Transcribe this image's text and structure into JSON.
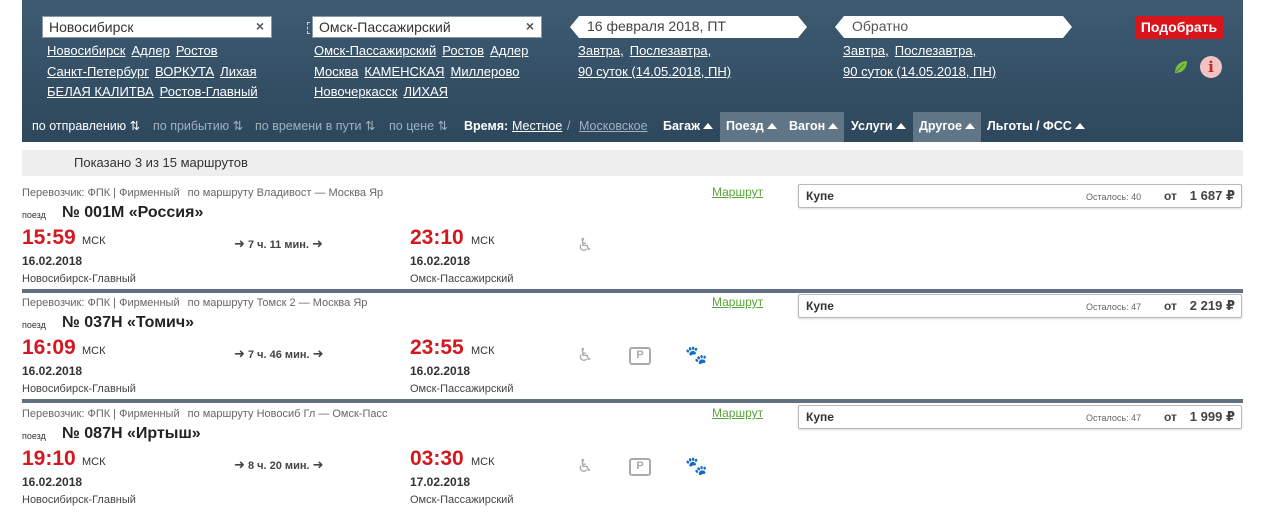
{
  "search": {
    "from_value": "Новосибирск",
    "to_value": "Омск-Пассажирский",
    "date_value": "16 февраля 2018, ПТ",
    "return_placeholder": "Обратно",
    "submit_label": "Подобрать",
    "from_suggestions": [
      "Новосибирск",
      "Адлер",
      "Ростов",
      "Санкт-Петербург",
      "ВОРКУТА",
      "Лихая",
      "БЕЛАЯ КАЛИТВА",
      "Ростов-Главный"
    ],
    "to_suggestions": [
      "Омск-Пассажирский",
      "Ростов",
      "Адлер",
      "Москва",
      "КАМЕНСКАЯ",
      "Миллерово",
      "Новочеркасск",
      "ЛИХАЯ"
    ],
    "date_suggestions": [
      "Завтра,",
      "Послезавтра,",
      "90 суток (14.05.2018, ПН)"
    ],
    "return_suggestions": [
      "Завтра,",
      "Послезавтра,",
      "90 суток (14.05.2018, ПН)"
    ],
    "clear_glyph": "×"
  },
  "filters": {
    "sort_departure": "по отправлению",
    "sort_arrival": "по прибытию",
    "sort_duration": "по времени в пути",
    "sort_price": "по цене",
    "time_label": "Время:",
    "time_local": "Местное",
    "time_sep": "/",
    "time_moscow": "Московское",
    "tabs": [
      "Багаж",
      "Поезд",
      "Вагон",
      "Услуги",
      "Другое",
      "Льготы / ФСС"
    ]
  },
  "summary": "Показано 3 из 15 маршрутов",
  "routes": [
    {
      "carrier": "Перевозчик: ФПК | Фирменный",
      "via": "по маршруту Владивост — Москва Яр",
      "train_label": "поезд",
      "train": "№ 001М «Россия»",
      "dep_time": "15:59",
      "dep_tz": "МСК",
      "dep_date": "16.02.2018",
      "dep_station": "Новосибирск-Главный",
      "duration": "7 ч. 11 мин.",
      "arr_time": "23:10",
      "arr_tz": "МСК",
      "arr_date": "16.02.2018",
      "arr_station": "Омск-Пассажирский",
      "route_link": "Маршрут",
      "coach": {
        "class": "Купе",
        "left": "Осталось: 40",
        "from": "от",
        "price": "1 687 ₽"
      }
    },
    {
      "carrier": "Перевозчик: ФПК | Фирменный",
      "via": "по маршруту Томск 2 — Москва Яр",
      "train_label": "поезд",
      "train": "№ 037Н «Томич»",
      "dep_time": "16:09",
      "dep_tz": "МСК",
      "dep_date": "16.02.2018",
      "dep_station": "Новосибирск-Главный",
      "duration": "7 ч. 46 мин.",
      "arr_time": "23:55",
      "arr_tz": "МСК",
      "arr_date": "16.02.2018",
      "arr_station": "Омск-Пассажирский",
      "route_link": "Маршрут",
      "coach": {
        "class": "Купе",
        "left": "Осталось: 47",
        "from": "от",
        "price": "2 219 ₽"
      }
    },
    {
      "carrier": "Перевозчик: ФПК | Фирменный",
      "via": "по маршруту Новосиб Гл — Омск-Пасс",
      "train_label": "поезд",
      "train": "№ 087Н «Иртыш»",
      "dep_time": "19:10",
      "dep_tz": "МСК",
      "dep_date": "16.02.2018",
      "dep_station": "Новосибирск-Главный",
      "duration": "8 ч. 20 мин.",
      "arr_time": "03:30",
      "arr_tz": "МСК",
      "arr_date": "17.02.2018",
      "arr_station": "Омск-Пассажирский",
      "route_link": "Маршрут",
      "coach": {
        "class": "Купе",
        "left": "Осталось: 47",
        "from": "от",
        "price": "1 999 ₽"
      }
    }
  ],
  "icons": {
    "wheelchair": "♿",
    "luggage": "P",
    "pet": "🐾",
    "info": "i",
    "arrow": "➜"
  },
  "colors": {
    "header": "#35506a",
    "accent_red": "#d9141a",
    "time_red": "#d3191f",
    "link_green": "#5aa53a"
  }
}
